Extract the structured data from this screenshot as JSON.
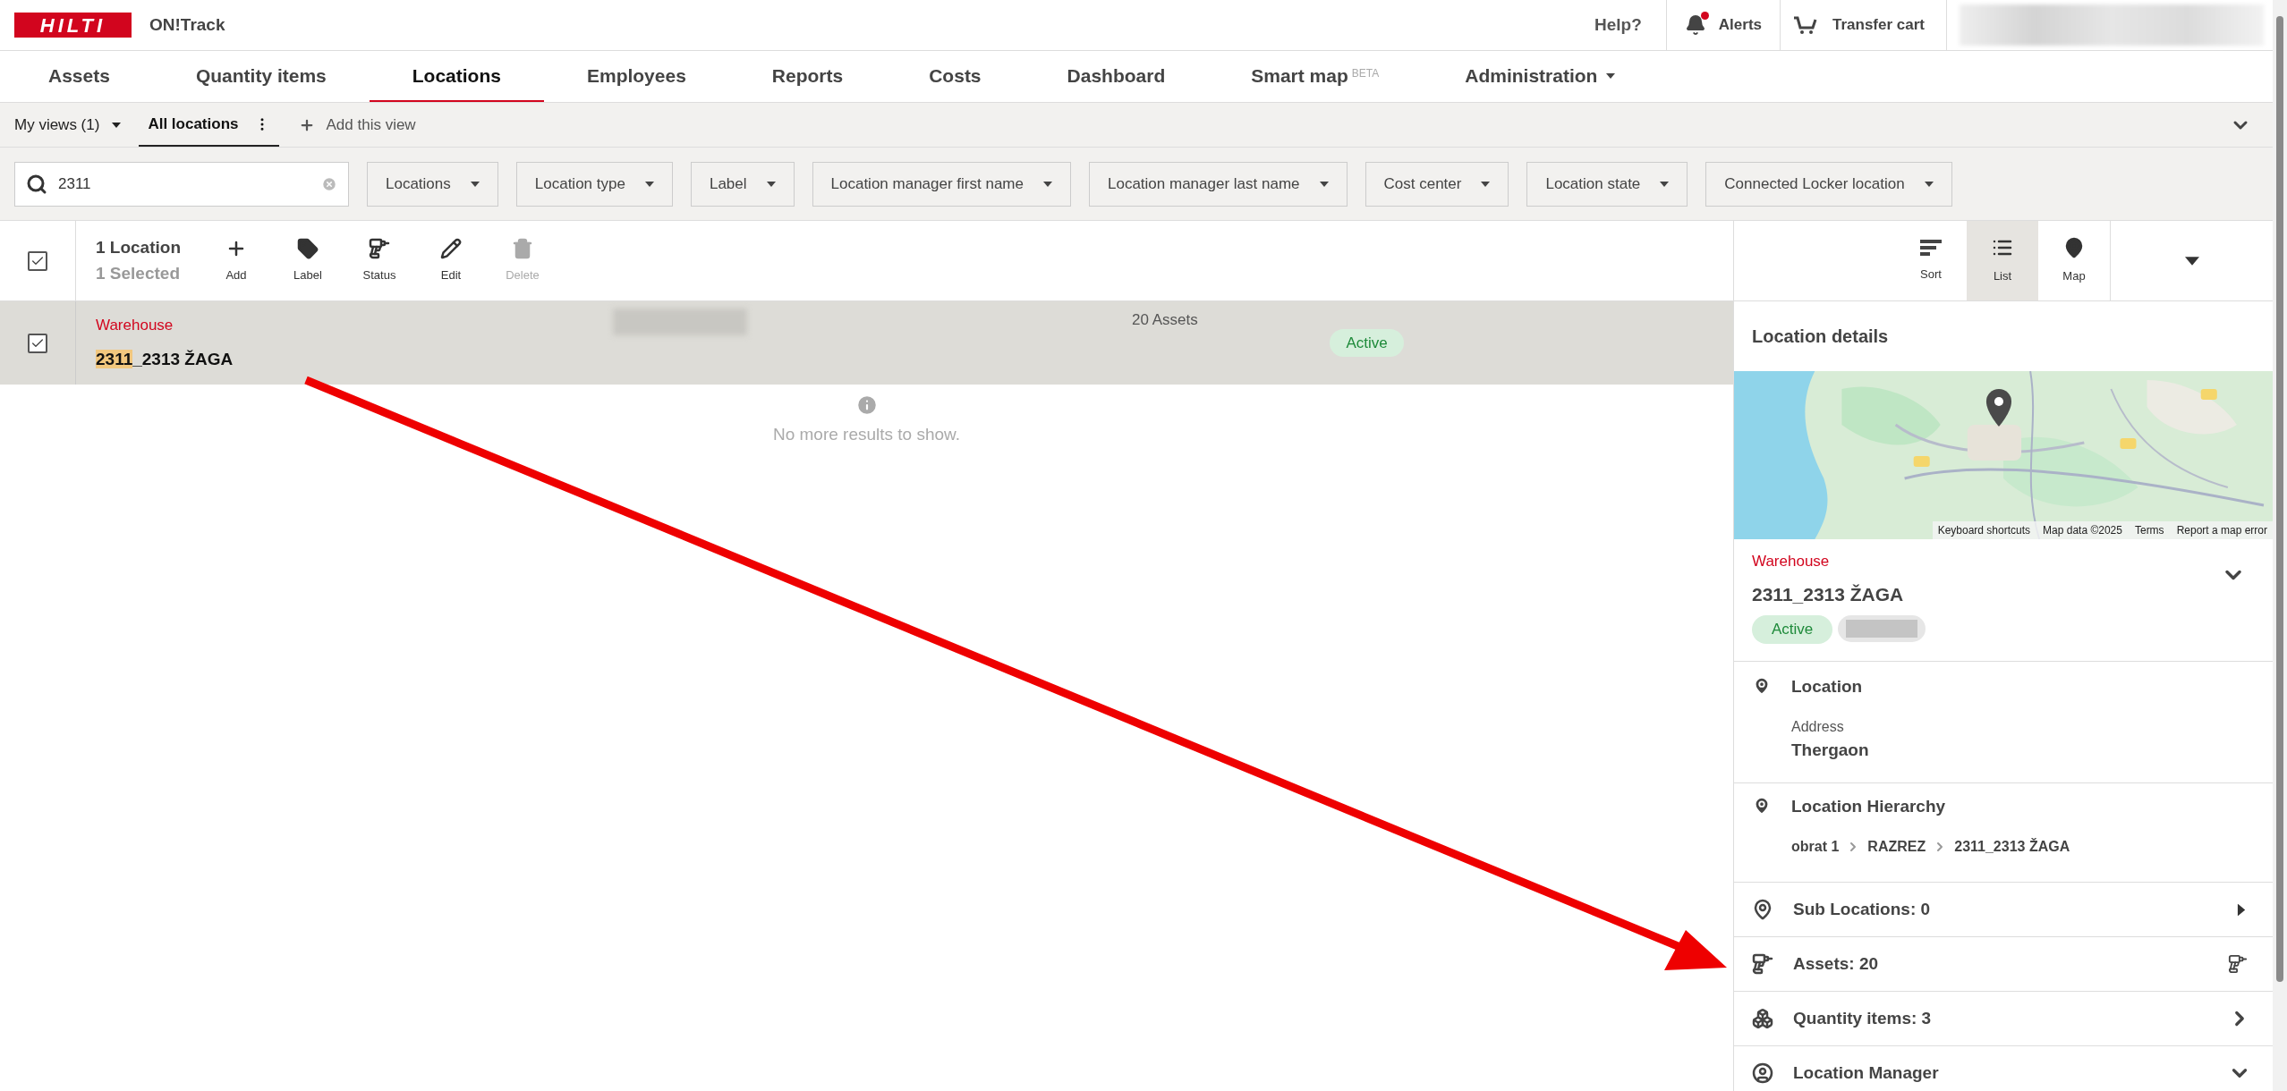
{
  "header": {
    "logo": "HILTI",
    "app_name": "ON!Track",
    "help": "Help?",
    "alerts": {
      "label": "Alerts",
      "unread": true
    },
    "transfer_cart": "Transfer cart"
  },
  "nav_tabs": [
    {
      "label": "Assets",
      "selected": false
    },
    {
      "label": "Quantity items",
      "selected": false
    },
    {
      "label": "Locations",
      "selected": true
    },
    {
      "label": "Employees",
      "selected": false
    },
    {
      "label": "Reports",
      "selected": false
    },
    {
      "label": "Costs",
      "selected": false
    },
    {
      "label": "Dashboard",
      "selected": false
    },
    {
      "label": "Smart map",
      "badge": "BETA",
      "selected": false
    },
    {
      "label": "Administration",
      "caret": true,
      "selected": false
    }
  ],
  "views": {
    "my_views": "My views (1)",
    "current": "All locations",
    "add": "Add this view"
  },
  "search": {
    "value": "2311"
  },
  "filters": [
    "Locations",
    "Location type",
    "Label",
    "Location manager first name",
    "Location manager last name",
    "Cost center",
    "Location state",
    "Connected Locker location"
  ],
  "toolbar": {
    "count": "1 Location",
    "selected_count": "1 Selected",
    "all_checked": true,
    "actions": [
      {
        "label": "Add",
        "disabled": false
      },
      {
        "label": "Label",
        "disabled": false
      },
      {
        "label": "Status",
        "disabled": false
      },
      {
        "label": "Edit",
        "disabled": false
      },
      {
        "label": "Delete",
        "disabled": true
      }
    ],
    "view_modes": [
      {
        "label": "Sort",
        "selected": false
      },
      {
        "label": "List",
        "selected": true
      },
      {
        "label": "Map",
        "selected": false
      }
    ]
  },
  "rows": [
    {
      "type": "Warehouse",
      "name_match": "2311",
      "name_rest": "_2313 ŽAGA",
      "assets": "20 Assets",
      "status": "Active",
      "checked": true,
      "selected": true
    }
  ],
  "empty_note": "No more results to show.",
  "details": {
    "title": "Location details",
    "map": {
      "kind": "picture",
      "attribution": [
        "Keyboard shortcuts",
        "Map data ©2025",
        "Terms",
        "Report a map error"
      ]
    },
    "type": "Warehouse",
    "name": "2311_2313 ŽAGA",
    "status": "Active",
    "location": {
      "title": "Location",
      "field_label": "Address",
      "field_value": "Thergaon"
    },
    "hierarchy": {
      "title": "Location Hierarchy",
      "path": [
        "obrat 1",
        "RAZREZ",
        "2311_2313 ŽAGA"
      ]
    },
    "links": [
      {
        "label": "Sub Locations: 0"
      },
      {
        "label": "Assets: 20"
      },
      {
        "label": "Quantity items: 3"
      },
      {
        "label": "Location Manager"
      }
    ]
  }
}
